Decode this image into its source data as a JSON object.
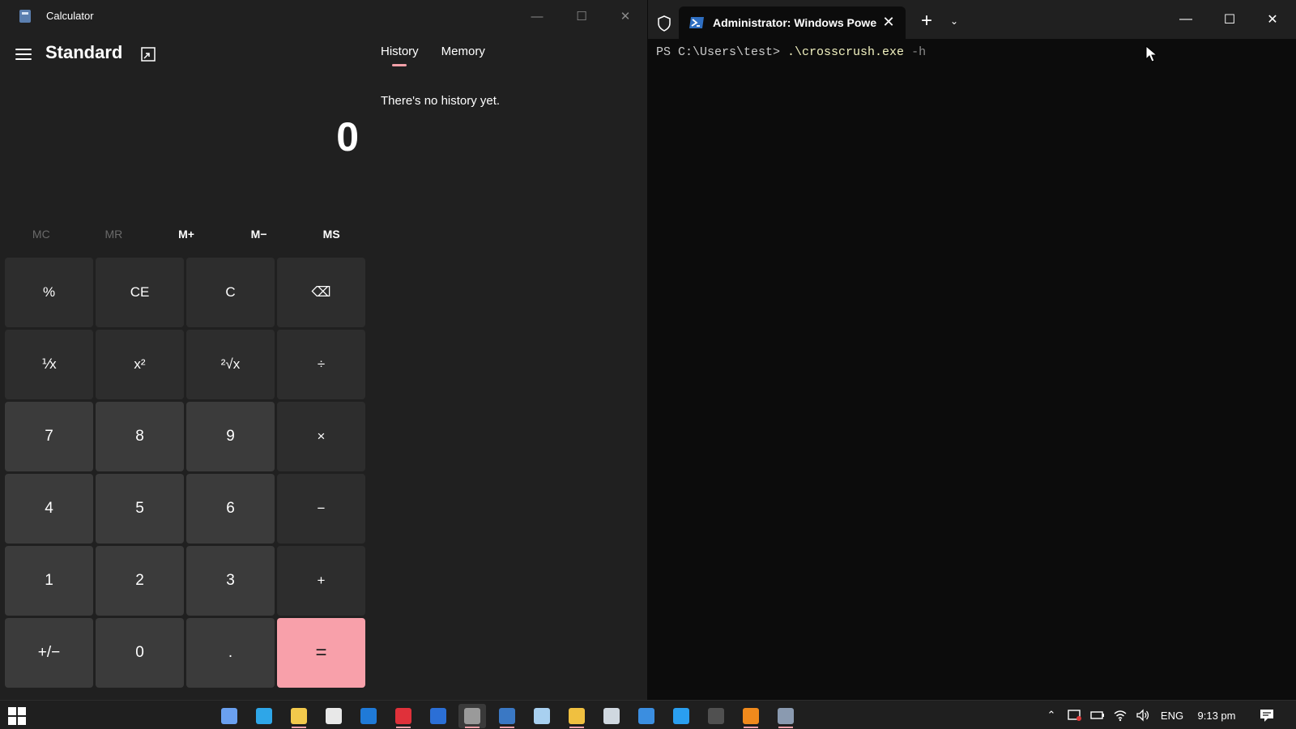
{
  "calculator": {
    "title": "Calculator",
    "mode": "Standard",
    "display_value": "0",
    "memory_buttons": [
      {
        "label": "MC",
        "enabled": false
      },
      {
        "label": "MR",
        "enabled": false
      },
      {
        "label": "M+",
        "enabled": true
      },
      {
        "label": "M−",
        "enabled": true
      },
      {
        "label": "MS",
        "enabled": true
      }
    ],
    "keys": [
      {
        "label": "%",
        "kind": "op",
        "name": "percent-button"
      },
      {
        "label": "CE",
        "kind": "op",
        "name": "clear-entry-button"
      },
      {
        "label": "C",
        "kind": "op",
        "name": "clear-button"
      },
      {
        "label": "⌫",
        "kind": "op",
        "name": "backspace-button"
      },
      {
        "label": "⅟x",
        "kind": "op",
        "name": "reciprocal-button"
      },
      {
        "label": "x²",
        "kind": "op",
        "name": "square-button"
      },
      {
        "label": "²√x",
        "kind": "op",
        "name": "square-root-button"
      },
      {
        "label": "÷",
        "kind": "op",
        "name": "divide-button"
      },
      {
        "label": "7",
        "kind": "num",
        "name": "digit-7-button"
      },
      {
        "label": "8",
        "kind": "num",
        "name": "digit-8-button"
      },
      {
        "label": "9",
        "kind": "num",
        "name": "digit-9-button"
      },
      {
        "label": "×",
        "kind": "op",
        "name": "multiply-button"
      },
      {
        "label": "4",
        "kind": "num",
        "name": "digit-4-button"
      },
      {
        "label": "5",
        "kind": "num",
        "name": "digit-5-button"
      },
      {
        "label": "6",
        "kind": "num",
        "name": "digit-6-button"
      },
      {
        "label": "−",
        "kind": "op",
        "name": "subtract-button"
      },
      {
        "label": "1",
        "kind": "num",
        "name": "digit-1-button"
      },
      {
        "label": "2",
        "kind": "num",
        "name": "digit-2-button"
      },
      {
        "label": "3",
        "kind": "num",
        "name": "digit-3-button"
      },
      {
        "label": "+",
        "kind": "op",
        "name": "add-button"
      },
      {
        "label": "+/−",
        "kind": "num",
        "name": "negate-button"
      },
      {
        "label": "0",
        "kind": "num",
        "name": "digit-0-button"
      },
      {
        "label": ".",
        "kind": "num",
        "name": "decimal-button"
      },
      {
        "label": "=",
        "kind": "equals",
        "name": "equals-button"
      }
    ],
    "tabs": [
      {
        "label": "History",
        "active": true
      },
      {
        "label": "Memory",
        "active": false
      }
    ],
    "history_empty_text": "There's no history yet."
  },
  "terminal": {
    "tab_title": "Administrator: Windows Powe",
    "prompt": "PS C:\\Users\\test> ",
    "command": ".\\crosscrush.exe",
    "argument": " -h"
  },
  "taskbar": {
    "apps": [
      {
        "name": "copilot-icon",
        "color": "#6aa0f0",
        "running": false
      },
      {
        "name": "edge-icon",
        "color": "#2ea6e8",
        "running": false
      },
      {
        "name": "file-explorer-icon",
        "color": "#f2c94c",
        "running": true
      },
      {
        "name": "store-icon",
        "color": "#e8e8e8",
        "running": false
      },
      {
        "name": "outlook-icon",
        "color": "#1f7ad8",
        "running": false
      },
      {
        "name": "wps-icon",
        "color": "#e0313a",
        "running": true
      },
      {
        "name": "word-icon",
        "color": "#2b6fd6",
        "running": false
      },
      {
        "name": "terminal-icon",
        "color": "#9a9a9a",
        "running": true
      },
      {
        "name": "powershell-icon",
        "color": "#3a78c4",
        "running": true
      },
      {
        "name": "notepad-icon",
        "color": "#a8d0f0",
        "running": false
      },
      {
        "name": "chrome-icon",
        "color": "#f0c040",
        "running": true
      },
      {
        "name": "remote-desktop-icon",
        "color": "#d0d8e0",
        "running": false
      },
      {
        "name": "grid-app-icon",
        "color": "#3b8ee0",
        "running": false
      },
      {
        "name": "vscode-icon",
        "color": "#2a9ff0",
        "running": false
      },
      {
        "name": "obs-icon",
        "color": "#505050",
        "running": false
      },
      {
        "name": "vlc-icon",
        "color": "#f08a1c",
        "running": true
      },
      {
        "name": "calculator-icon",
        "color": "#8a9ab0",
        "running": true
      }
    ],
    "language": "ENG",
    "time": "9:13 pm"
  }
}
